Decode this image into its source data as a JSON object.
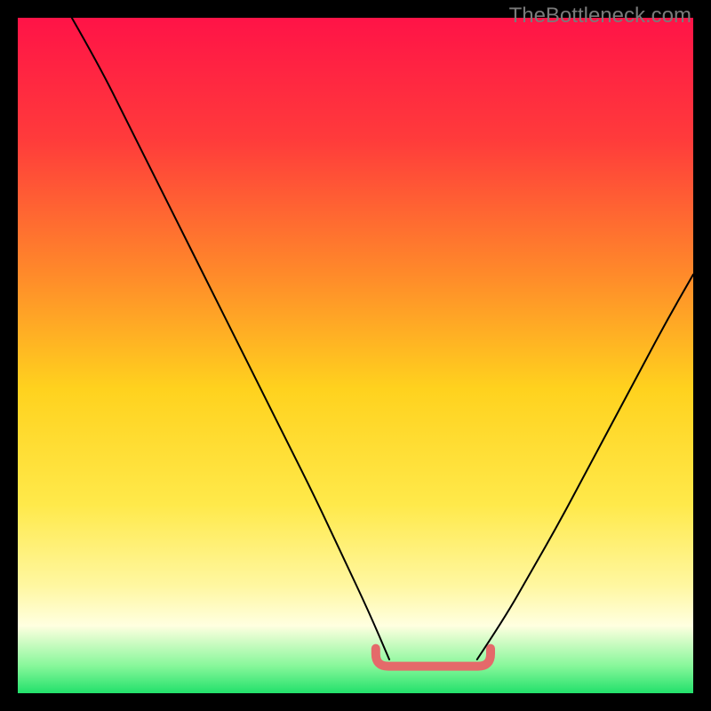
{
  "watermark": "TheBottleneck.com",
  "chart_data": {
    "type": "line",
    "title": "",
    "xlabel": "",
    "ylabel": "",
    "xlim": [
      0,
      100
    ],
    "ylim": [
      0,
      100
    ],
    "grid": false,
    "legend": false,
    "background": {
      "type": "vertical_heat_gradient",
      "stops": [
        {
          "pos": 0.0,
          "color": "#ff1347"
        },
        {
          "pos": 0.18,
          "color": "#ff3b3b"
        },
        {
          "pos": 0.38,
          "color": "#ff8a2a"
        },
        {
          "pos": 0.55,
          "color": "#ffd21e"
        },
        {
          "pos": 0.72,
          "color": "#ffe94a"
        },
        {
          "pos": 0.84,
          "color": "#fff7a0"
        },
        {
          "pos": 0.9,
          "color": "#ffffe0"
        },
        {
          "pos": 0.96,
          "color": "#86f79a"
        },
        {
          "pos": 1.0,
          "color": "#22e06b"
        }
      ]
    },
    "annotations": [
      {
        "type": "sweet_spot_indicator",
        "shape": "rounded_U",
        "x_start": 53,
        "x_end": 70,
        "y": 4,
        "color": "#e46a6a"
      }
    ],
    "series": [
      {
        "name": "left_curve",
        "color": "#000000",
        "x": [
          8,
          12,
          16,
          20,
          24,
          28,
          32,
          36,
          40,
          44,
          48,
          52,
          55
        ],
        "y": [
          100,
          93,
          85,
          77,
          69,
          61,
          53,
          45,
          37,
          29,
          20.5,
          12,
          5
        ]
      },
      {
        "name": "right_curve",
        "color": "#000000",
        "x": [
          68,
          72,
          76,
          80,
          84,
          88,
          92,
          96,
          100
        ],
        "y": [
          5,
          11,
          18,
          25,
          32.5,
          40,
          47.5,
          55,
          62
        ]
      }
    ]
  }
}
